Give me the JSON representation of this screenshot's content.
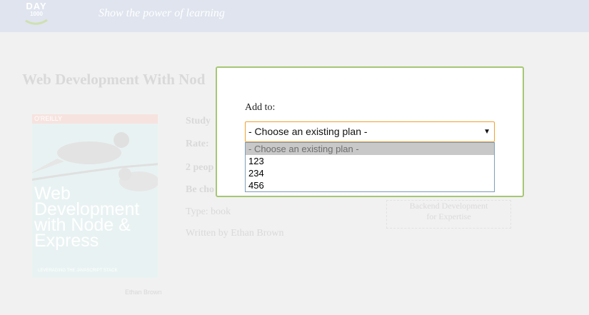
{
  "header": {
    "logo_day": "DAY",
    "logo_num": "1000",
    "tagline": "Show the power of learning"
  },
  "book": {
    "title": "Web Development With Nod",
    "cover_publisher": "O'REILLY",
    "cover_title": "Web Development with Node & Express",
    "cover_subtitle": "LEVERAGING THE JAVASCRIPT STACK",
    "cover_author": "Ethan Brown",
    "info": {
      "study": "Study",
      "rate": "Rate:",
      "people": "2 peop",
      "be_chosen": "Be cho",
      "type": "Type: book",
      "written_by": "Written by Ethan Brown"
    },
    "related_line1": "Backend Development",
    "related_line2": "for Expertise"
  },
  "modal": {
    "add_label": "Add to:",
    "select": {
      "value": "- Choose an existing plan -",
      "arrow": "▼",
      "options": [
        "- Choose an existing plan -",
        "123",
        "234",
        "456"
      ],
      "selected_index": 0
    }
  },
  "colors": {
    "header_bg": "#dfe4ee",
    "modal_border": "#a6c773",
    "select_border": "#f0a030",
    "dropdown_border": "#7f9db9",
    "highlight": "#c8c8c8"
  }
}
